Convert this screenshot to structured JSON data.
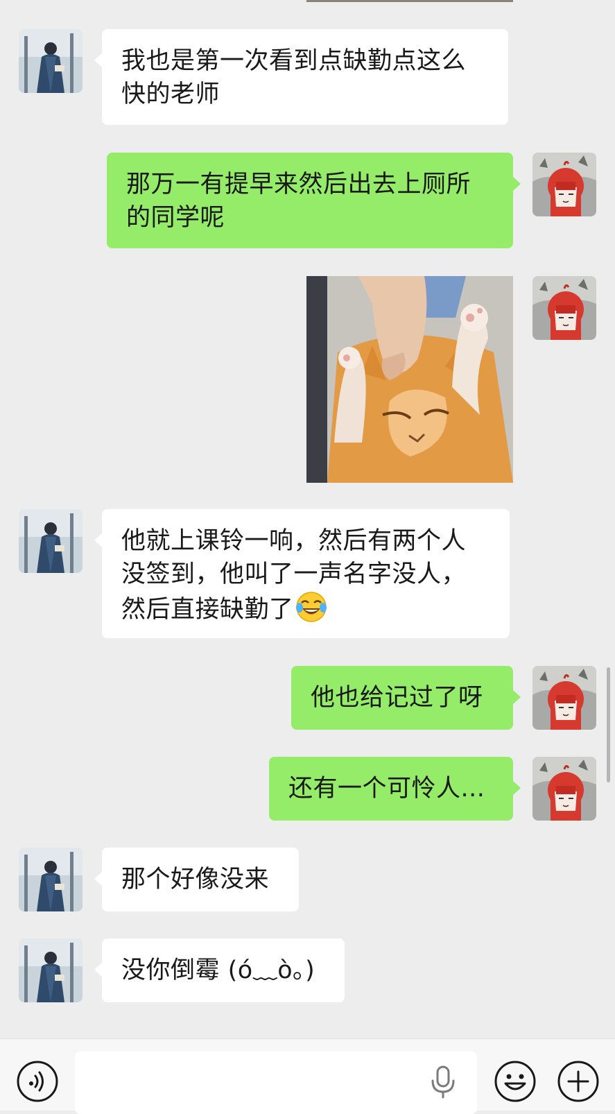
{
  "conversation": {
    "messages": [
      {
        "from": "friend",
        "type": "text",
        "text": "我也是第一次看到点缺勤点这么\n快的老师"
      },
      {
        "from": "me",
        "type": "text",
        "text": "那万一有提早来然后出去上厕所\n的同学呢"
      },
      {
        "from": "me",
        "type": "sticker",
        "sticker": "orange-cat-sticker"
      },
      {
        "from": "friend",
        "type": "text",
        "text": "他就上课铃一响，然后有两个人\n没签到，他叫了一声名字没人，\n然后直接缺勤了",
        "emoji": "tears-of-joy-emoji"
      },
      {
        "from": "me",
        "type": "text",
        "text": "他也给记过了呀"
      },
      {
        "from": "me",
        "type": "text",
        "text": "还有一个可怜人..."
      },
      {
        "from": "friend",
        "type": "text",
        "text": "那个好像没来"
      },
      {
        "from": "friend",
        "type": "text",
        "text": "没你倒霉 (ó﹏ò｡)"
      }
    ]
  },
  "colors": {
    "background": "#ededed",
    "incoming_bubble": "#ffffff",
    "outgoing_bubble": "#95ec69",
    "input_bar": "#f7f7f7"
  },
  "input_bar": {
    "icons": [
      "voice-mode-icon",
      "microphone-icon",
      "emoji-icon",
      "plus-icon"
    ],
    "value": ""
  }
}
